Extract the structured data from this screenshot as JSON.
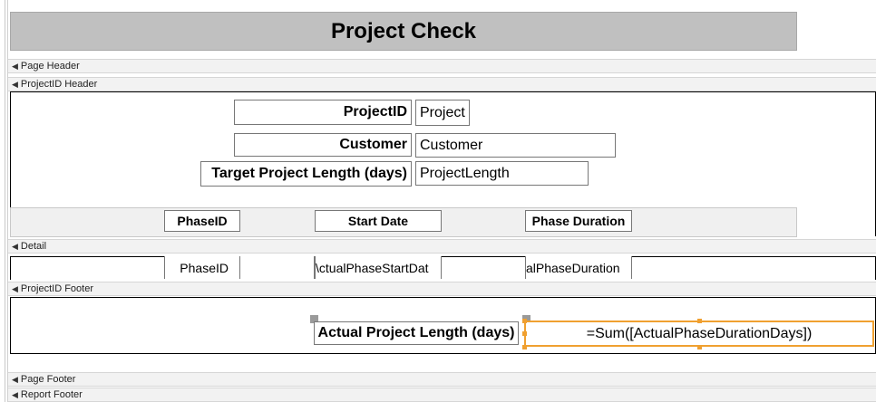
{
  "report": {
    "title": "Project Check"
  },
  "sections": {
    "page_header": "Page Header",
    "projectid_header": "ProjectID Header",
    "detail": "Detail",
    "projectid_footer": "ProjectID Footer",
    "page_footer": "Page Footer",
    "report_footer": "Report Footer"
  },
  "header_fields": {
    "projectid_label": "ProjectID",
    "projectid_value": "Project",
    "customer_label": "Customer",
    "customer_value": "Customer",
    "target_label": "Target Project Length (days)",
    "target_value": "ProjectLength"
  },
  "column_heads": {
    "phaseid": "PhaseID",
    "start_date": "Start Date",
    "phase_duration": "Phase Duration"
  },
  "detail_fields": {
    "phaseid": "PhaseID",
    "start_date": "\\ctualPhaseStartDat",
    "phase_duration": "alPhaseDuration"
  },
  "footer_fields": {
    "actual_label": "Actual Project Length (days)",
    "actual_expr": "=Sum([ActualPhaseDurationDays])"
  },
  "colors": {
    "selection": "#f0a030",
    "band_gray": "#c0c0c0"
  }
}
